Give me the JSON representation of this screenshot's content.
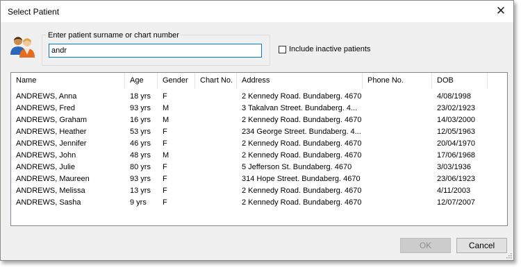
{
  "window": {
    "title": "Select Patient"
  },
  "search": {
    "group_label": "Enter patient surname or chart number",
    "value": "andr"
  },
  "options": {
    "include_inactive_label": "Include inactive patients",
    "include_inactive_checked": false
  },
  "columns": [
    "Name",
    "Age",
    "Gender",
    "Chart No.",
    "Address",
    "Phone No.",
    "DOB"
  ],
  "patients": [
    {
      "name": "ANDREWS, Anna",
      "age": "18 yrs",
      "gender": "F",
      "chart": "",
      "address": "2 Kennedy Road. Bundaberg. 4670",
      "phone": "",
      "dob": "4/08/1998"
    },
    {
      "name": "ANDREWS, Fred",
      "age": "93 yrs",
      "gender": "M",
      "chart": "",
      "address": "3 Takalvan Street. Bundaberg. 4...",
      "phone": "",
      "dob": "23/02/1923"
    },
    {
      "name": "ANDREWS, Graham",
      "age": "16 yrs",
      "gender": "M",
      "chart": "",
      "address": "2 Kennedy Road. Bundaberg. 4670",
      "phone": "",
      "dob": "14/03/2000"
    },
    {
      "name": "ANDREWS, Heather",
      "age": "53 yrs",
      "gender": "F",
      "chart": "",
      "address": "234 George Street. Bundaberg. 4...",
      "phone": "",
      "dob": "12/05/1963"
    },
    {
      "name": "ANDREWS, Jennifer",
      "age": "46 yrs",
      "gender": "F",
      "chart": "",
      "address": "2 Kennedy Road. Bundaberg. 4670",
      "phone": "",
      "dob": "20/04/1970"
    },
    {
      "name": "ANDREWS, John",
      "age": "48 yrs",
      "gender": "M",
      "chart": "",
      "address": "2 Kennedy Road. Bundaberg. 4670",
      "phone": "",
      "dob": "17/06/1968"
    },
    {
      "name": "ANDREWS, Julie",
      "age": "80 yrs",
      "gender": "F",
      "chart": "",
      "address": "5 Jefferson St. Bundaberg. 4670",
      "phone": "",
      "dob": "3/03/1936"
    },
    {
      "name": "ANDREWS, Maureen",
      "age": "93 yrs",
      "gender": "F",
      "chart": "",
      "address": "314 Hope Street. Bundaberg. 4670",
      "phone": "",
      "dob": "23/06/1923"
    },
    {
      "name": "ANDREWS, Melissa",
      "age": "13 yrs",
      "gender": "F",
      "chart": "",
      "address": "2 Kennedy Road. Bundaberg. 4670",
      "phone": "",
      "dob": "4/11/2003"
    },
    {
      "name": "ANDREWS, Sasha",
      "age": "9 yrs",
      "gender": "F",
      "chart": "",
      "address": "2 Kennedy Road. Bundaberg. 4670",
      "phone": "",
      "dob": "12/07/2007"
    }
  ],
  "buttons": {
    "ok": "OK",
    "cancel": "Cancel",
    "ok_enabled": false
  },
  "icons": {
    "close": "close-icon",
    "patients": "patients-icon",
    "resize": "resize-grip-icon"
  },
  "colors": {
    "accent": "#0078d7",
    "dialog_bg": "#f0f0f0",
    "list_bg": "#ffffff"
  }
}
